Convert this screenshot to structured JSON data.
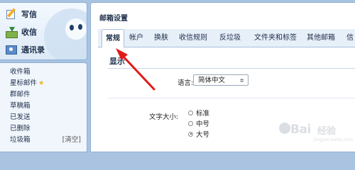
{
  "actions": {
    "write": "写信",
    "inbox": "收信",
    "contacts": "通讯录"
  },
  "folders": {
    "inbox": "收件箱",
    "starred": "星标邮件",
    "starred_icon": "star-icon",
    "group": "群邮件",
    "drafts": "草稿箱",
    "sent": "已发送",
    "deleted": "已删除",
    "spam": "垃圾箱",
    "spam_clear": "[清空]"
  },
  "main": {
    "title": "邮箱设置",
    "tabs": [
      "常规",
      "帐户",
      "换肤",
      "收信规则",
      "反垃圾",
      "文件夹和标签",
      "其他邮箱",
      "信"
    ],
    "active_tab": "常规",
    "section_heading": "显示",
    "language": {
      "label": "语言:",
      "value": "简体中文",
      "arrow": "≑"
    },
    "font_size": {
      "label": "文字大小:",
      "options": [
        "标准",
        "中号",
        "大号"
      ],
      "selected": "大号"
    }
  },
  "watermark": {
    "text": "Bai",
    "text2": "经验",
    "url": "jingyan.baidu.com"
  },
  "colors": {
    "background": "#a9c3e1",
    "arrow": "#e11a1a",
    "text": "#1d2f4a"
  }
}
